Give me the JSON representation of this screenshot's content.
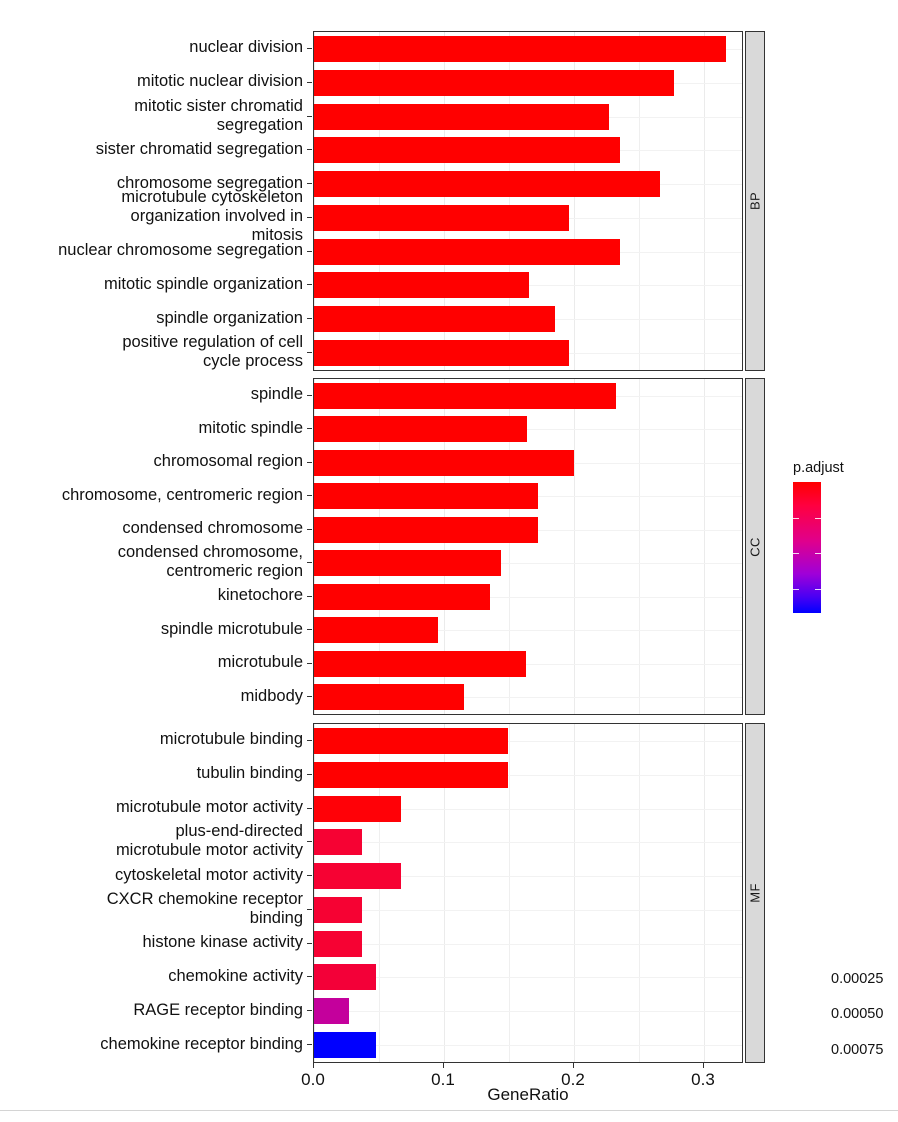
{
  "figure": {
    "background": "#ffffff",
    "bar_default_color": "#FF0000",
    "panel_strip_color": "#D9D9D9",
    "gridline_color": "#EBEBEB"
  },
  "axes": {
    "x_title": "GeneRatio",
    "x_tick_labels": [
      "0.0",
      "0.1",
      "0.2",
      "0.3"
    ],
    "x_tick_values": [
      0.0,
      0.1,
      0.2,
      0.3
    ],
    "x_min": 0.0,
    "x_max": 0.33,
    "x_minor_gridlines": [
      0.05,
      0.15,
      0.25
    ],
    "y_title": ""
  },
  "legend": {
    "title": "p.adjust",
    "tick_labels": [
      "0.00025",
      "0.00050",
      "0.00075"
    ],
    "tick_values": [
      0.00025,
      0.0005,
      0.00075
    ],
    "gradient_high_color": "#FF0000",
    "gradient_low_color": "#0000FF",
    "position": "right"
  },
  "panels": [
    {
      "id": "BP",
      "strip_label": "BP"
    },
    {
      "id": "CC",
      "strip_label": "CC"
    },
    {
      "id": "MF",
      "strip_label": "MF"
    }
  ],
  "chart_data": {
    "type": "bar",
    "orientation": "horizontal",
    "title": "",
    "xlabel": "GeneRatio",
    "ylabel": "",
    "xlim": [
      0.0,
      0.33
    ],
    "grid": true,
    "legend": {
      "title": "p.adjust",
      "position": "right"
    },
    "color_scale": {
      "variable": "p.adjust",
      "high_value_color": "#0000FF",
      "low_value_color": "#FF0000",
      "breaks": [
        0.00025,
        0.0005,
        0.00075
      ]
    },
    "facets": [
      {
        "name": "BP",
        "categories": [
          "nuclear division",
          "mitotic nuclear division",
          "mitotic sister chromatid\nsegregation",
          "sister chromatid segregation",
          "chromosome segregation",
          "microtubule cytoskeleton\norganization involved in\nmitosis",
          "nuclear chromosome segregation",
          "mitotic spindle organization",
          "spindle organization",
          "positive regulation of cell\ncycle process"
        ],
        "values": [
          0.317,
          0.277,
          0.227,
          0.235,
          0.266,
          0.196,
          0.235,
          0.165,
          0.185,
          0.196
        ],
        "colors": [
          "#FF0000",
          "#FF0000",
          "#FF0000",
          "#FF0000",
          "#FF0000",
          "#FF0000",
          "#FF0000",
          "#FF0000",
          "#FF0000",
          "#FF0000"
        ]
      },
      {
        "name": "CC",
        "categories": [
          "spindle",
          "mitotic spindle",
          "chromosomal region",
          "chromosome, centromeric region",
          "condensed chromosome",
          "condensed chromosome,\ncentromeric region",
          "kinetochore",
          "spindle microtubule",
          "microtubule",
          "midbody"
        ],
        "values": [
          0.232,
          0.164,
          0.2,
          0.172,
          0.172,
          0.144,
          0.135,
          0.095,
          0.163,
          0.115
        ],
        "colors": [
          "#FF0000",
          "#FF0000",
          "#FF0000",
          "#FF0000",
          "#FF0000",
          "#FF0000",
          "#FF0000",
          "#FF0000",
          "#FF0000",
          "#FF0000"
        ]
      },
      {
        "name": "MF",
        "categories": [
          "microtubule binding",
          "tubulin binding",
          "microtubule motor activity",
          "plus-end-directed\nmicrotubule motor activity",
          "cytoskeletal motor activity",
          "CXCR chemokine receptor\nbinding",
          "histone kinase activity",
          "chemokine activity",
          "RAGE receptor binding",
          "chemokine receptor binding"
        ],
        "values": [
          0.149,
          0.149,
          0.067,
          0.037,
          0.067,
          0.037,
          0.037,
          0.048,
          0.027,
          0.048
        ],
        "colors": [
          "#FF0000",
          "#FF0000",
          "#FF0107",
          "#F60233",
          "#F60233",
          "#F60233",
          "#F60233",
          "#F30038",
          "#C4009C",
          "#0000FF"
        ]
      }
    ]
  }
}
